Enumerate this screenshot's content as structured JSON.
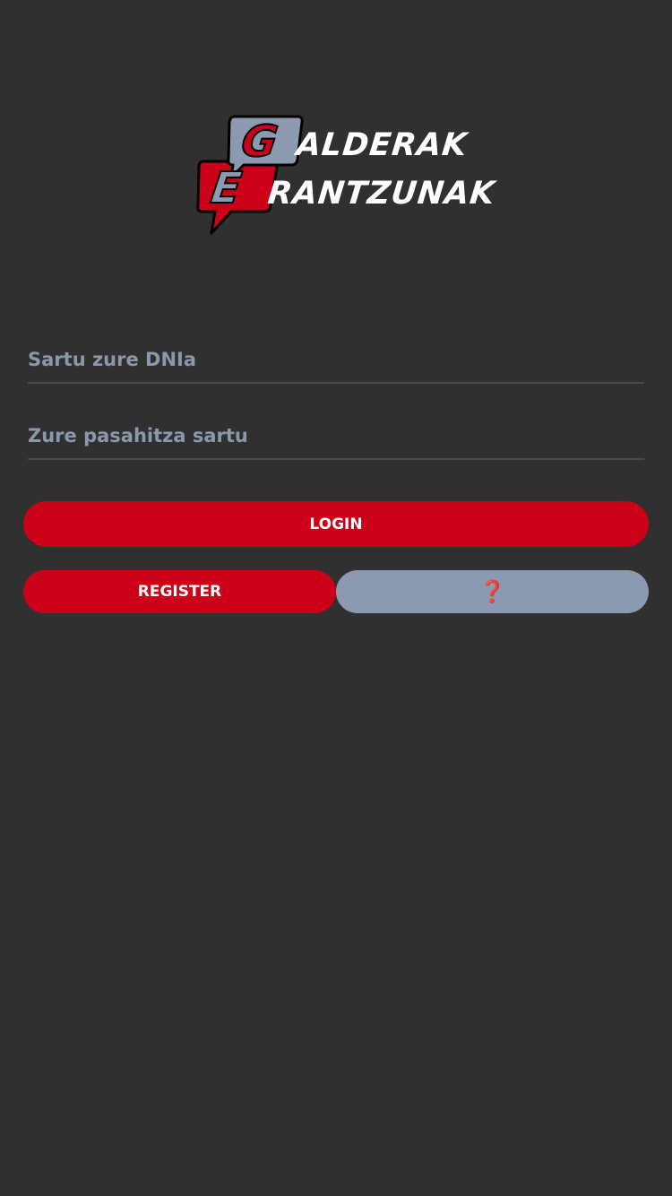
{
  "logo": {
    "letter_1": "G",
    "letter_2": "E",
    "word_1": "ALDERAK",
    "word_2": "RANTZUNAK",
    "colors": {
      "bubble_grey": "#8b9ab1",
      "bubble_red": "#cc0018",
      "outline": "#000000",
      "text": "#ffffff"
    }
  },
  "form": {
    "dni_placeholder": "Sartu zure DNIa",
    "dni_value": "",
    "password_placeholder": "Zure pasahitza sartu",
    "password_value": ""
  },
  "actions": {
    "login_label": "LOGIN",
    "register_label": "REGISTER",
    "help_icon": "question-mark-icon",
    "help_glyph": "❓"
  },
  "colors": {
    "background": "#303030",
    "accent_red": "#cc0018",
    "secondary_grey": "#8b9ab1",
    "placeholder": "#8b97ab",
    "underline": "#4a4a4a"
  }
}
